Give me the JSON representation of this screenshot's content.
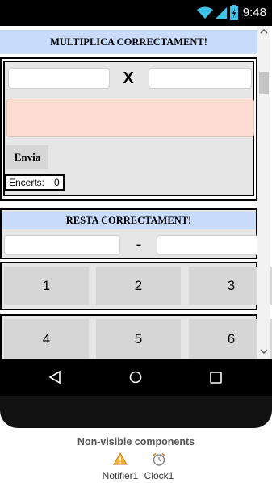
{
  "status_bar": {
    "time": "9:48",
    "icons": [
      "wifi-icon",
      "signal-icon",
      "battery-icon"
    ]
  },
  "multiply": {
    "title": "MULTIPLICA CORRECTAMENT!",
    "operator": "X",
    "input_a": "",
    "input_b": "",
    "result": "",
    "send_label": "Envia",
    "score_label": "Encerts:",
    "score_value": "0"
  },
  "subtract": {
    "title": "RESTA CORRECTAMENT!",
    "operator": "-",
    "input_a": "",
    "input_b": ""
  },
  "keypad": {
    "row1": [
      "1",
      "2",
      "3"
    ],
    "row2": [
      "4",
      "5",
      "6"
    ]
  },
  "navigation": {
    "buttons": [
      "back-icon",
      "home-icon",
      "recents-icon"
    ]
  },
  "non_visible": {
    "title": "Non-visible components",
    "items": [
      {
        "icon": "warning-icon",
        "label": "Notifier1"
      },
      {
        "icon": "alarm-clock-icon",
        "label": "Clock1"
      }
    ]
  },
  "colors": {
    "title_bg": "#c9dcfc",
    "result_bg": "#fcdcd0",
    "button_bg": "#d6d6d6",
    "panel_bg": "#e6e6e6"
  }
}
